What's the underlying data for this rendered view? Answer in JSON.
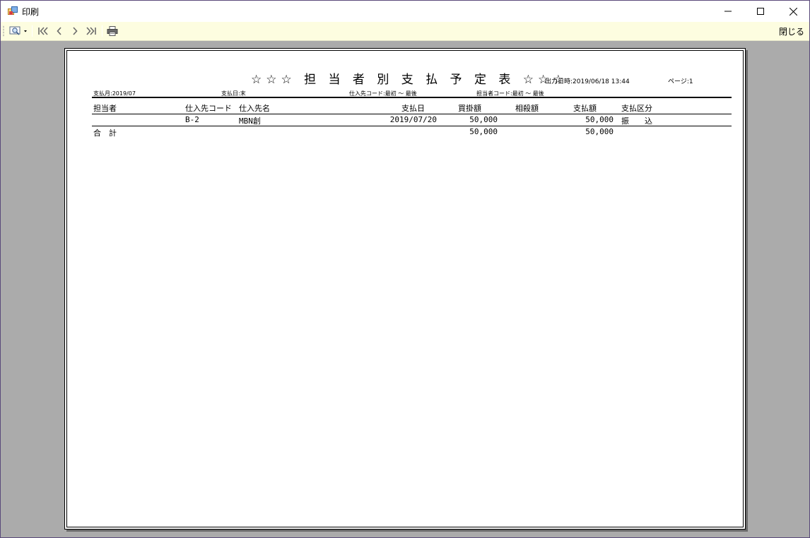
{
  "window": {
    "title": "印刷",
    "icon": "print-preview-app-icon"
  },
  "toolbar": {
    "zoom_icon": "magnifier-icon",
    "first_icon": "first-page-icon",
    "prev_icon": "previous-page-icon",
    "next_icon": "next-page-icon",
    "last_icon": "last-page-icon",
    "print_icon": "printer-icon",
    "close_label": "閉じる"
  },
  "report": {
    "title": "☆☆☆ 担 当 者 別 支 払 予 定 表 ☆☆☆",
    "output_datetime": "出力日時:2019/06/18 13:44",
    "page": "ページ:1",
    "conditions": {
      "pay_month": "支払月:2019/07",
      "pay_day": "支払日:末",
      "supplier_code": "仕入先コード:最初 ～ 最後",
      "staff_code": "担当者コード:最初 ～ 最後"
    },
    "columns": {
      "staff": "担当者",
      "supplier_code": "仕入先コード",
      "supplier_name": "仕入先名",
      "pay_date": "支払日",
      "payable": "買掛額",
      "offset": "相殺額",
      "payment": "支払額",
      "pay_type": "支払区分"
    },
    "rows": [
      {
        "staff": "",
        "supplier_code": "B-2",
        "supplier_name": "MBN創",
        "pay_date": "2019/07/20",
        "payable": "50,000",
        "offset": "",
        "payment": "50,000",
        "pay_type": "振　　込"
      }
    ],
    "total": {
      "label": "合　計",
      "payable": "50,000",
      "payment": "50,000"
    }
  }
}
